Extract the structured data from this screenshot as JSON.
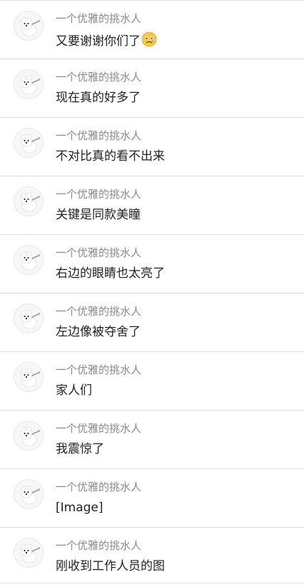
{
  "messages": [
    {
      "name": "一个优雅的挑水人",
      "text": "又要谢谢你们了",
      "emoji": "holding-back-tears-emoji"
    },
    {
      "name": "一个优雅的挑水人",
      "text": "现在真的好多了"
    },
    {
      "name": "一个优雅的挑水人",
      "text": "不对比真的看不出来"
    },
    {
      "name": "一个优雅的挑水人",
      "text": "关键是同款美瞳"
    },
    {
      "name": "一个优雅的挑水人",
      "text": "右边的眼睛也太亮了"
    },
    {
      "name": "一个优雅的挑水人",
      "text": "左边像被夺舍了"
    },
    {
      "name": "一个优雅的挑水人",
      "text": "家人们"
    },
    {
      "name": "一个优雅的挑水人",
      "text": "我震惊了"
    },
    {
      "name": "一个优雅的挑水人",
      "text": "[Image]"
    },
    {
      "name": "一个优雅的挑水人",
      "text": "刚收到工作人员的图"
    }
  ],
  "avatar_icon": "white-dog-avatar-icon",
  "colors": {
    "name_text": "#8a8a8a",
    "message_text": "#222222",
    "divider": "#dedede"
  }
}
